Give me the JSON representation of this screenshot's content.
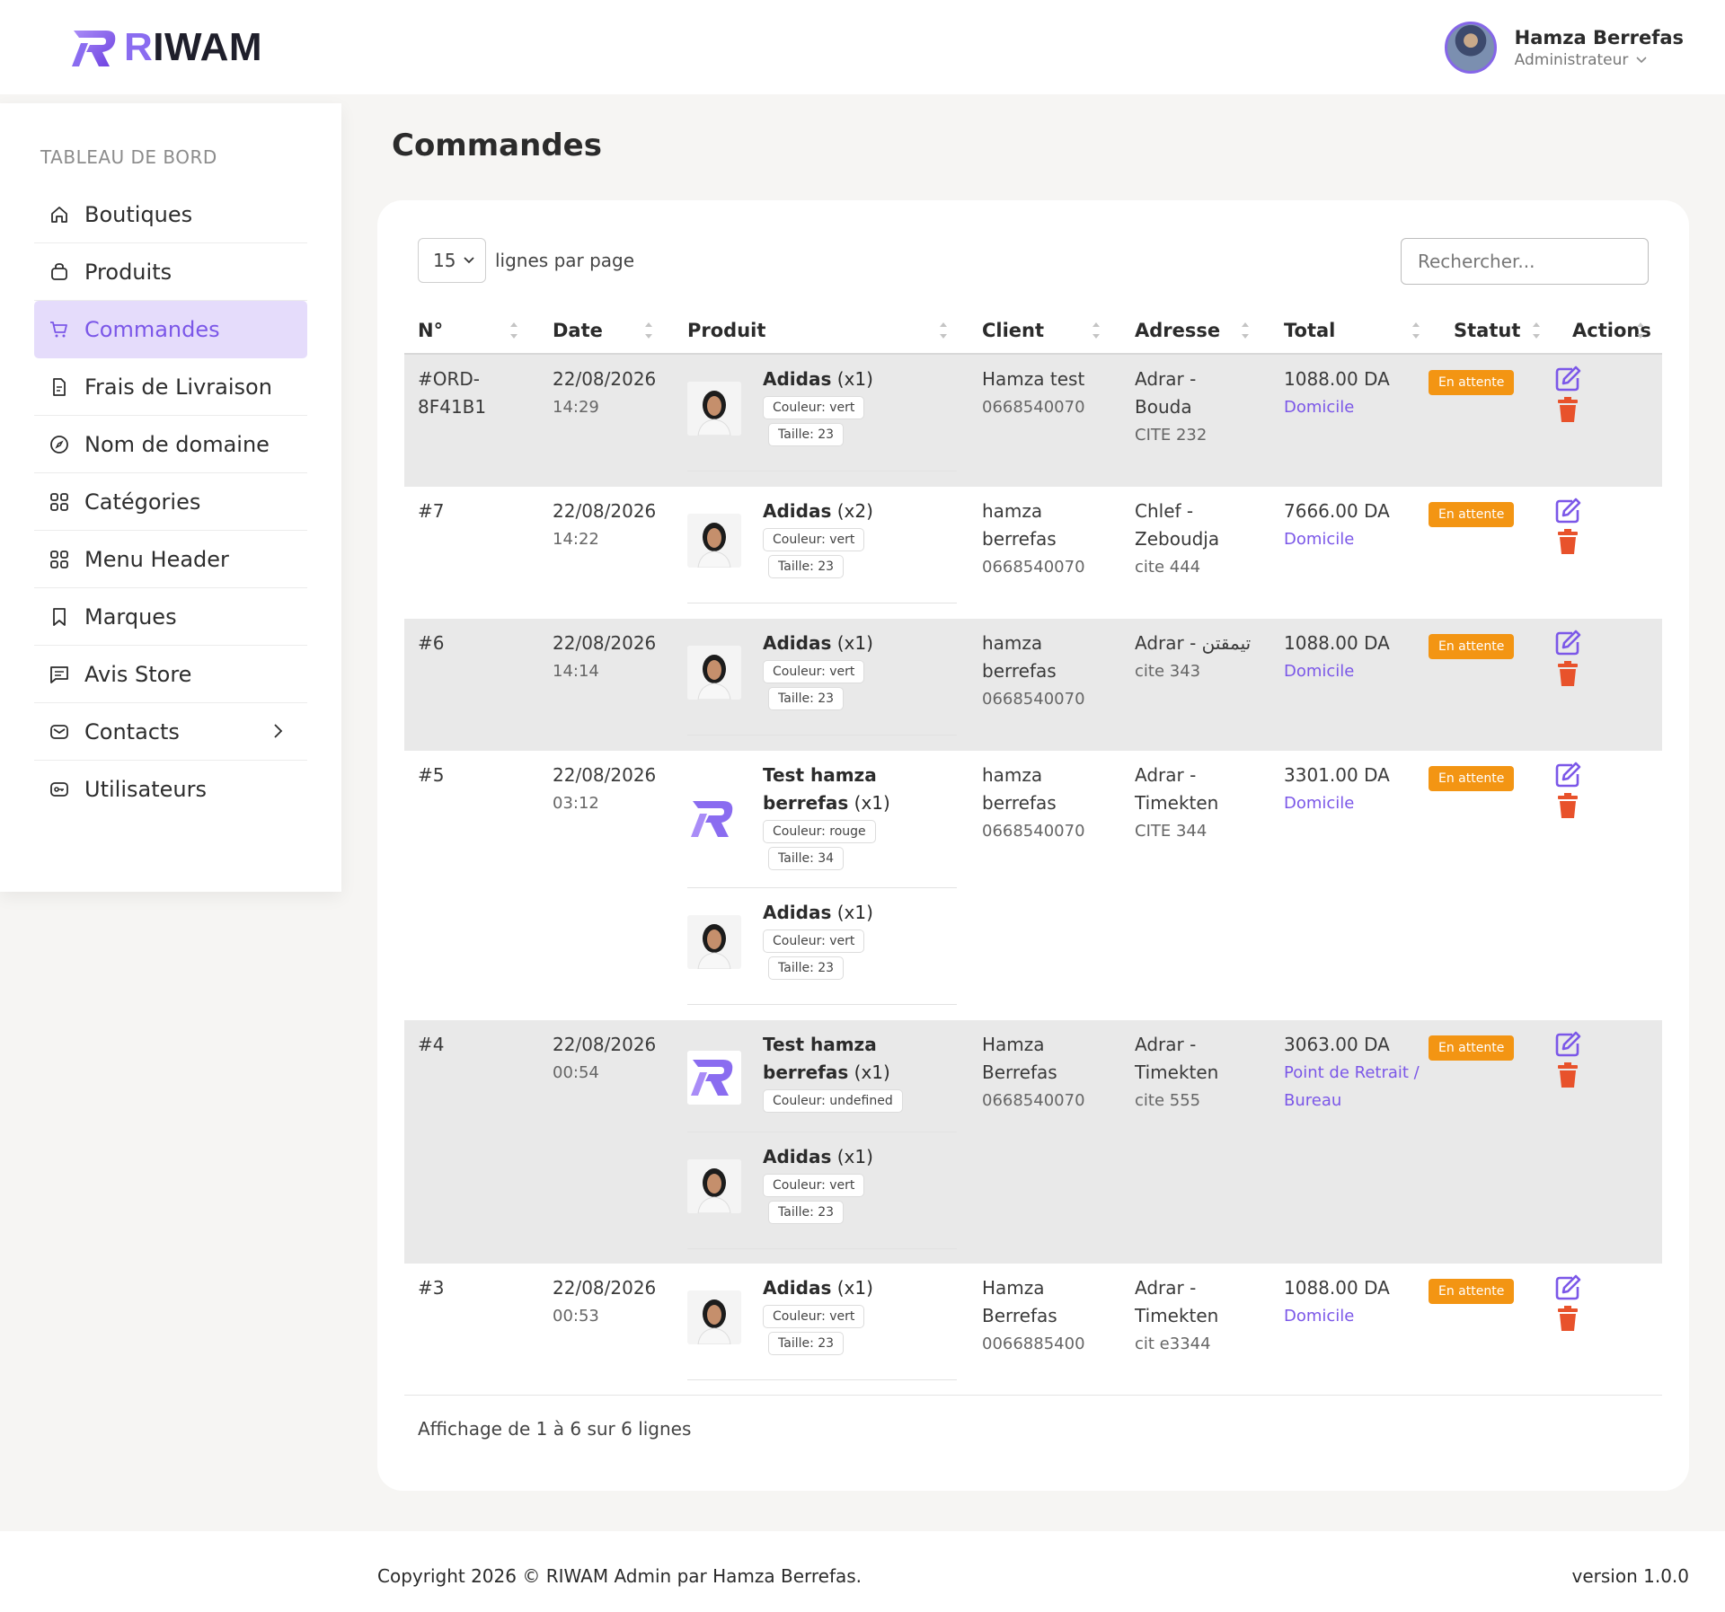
{
  "brand": {
    "name_first": "R",
    "name_rest": "IWAM",
    "accent": "#8a6cf0"
  },
  "user": {
    "name": "Hamza Berrefas",
    "role": "Administrateur"
  },
  "sidebar": {
    "title": "TABLEAU DE BORD",
    "items": [
      {
        "label": "Boutiques",
        "icon": "home-icon"
      },
      {
        "label": "Produits",
        "icon": "bag-icon"
      },
      {
        "label": "Commandes",
        "icon": "cart-icon",
        "active": true
      },
      {
        "label": "Frais de Livraison",
        "icon": "document-icon"
      },
      {
        "label": "Nom de domaine",
        "icon": "compass-icon"
      },
      {
        "label": "Catégories",
        "icon": "grid-icon"
      },
      {
        "label": "Menu Header",
        "icon": "grid-icon"
      },
      {
        "label": "Marques",
        "icon": "bookmark-icon"
      },
      {
        "label": "Avis Store",
        "icon": "comment-icon"
      },
      {
        "label": "Contacts",
        "icon": "mail-icon"
      },
      {
        "label": "Utilisateurs",
        "icon": "key-icon"
      }
    ]
  },
  "page": {
    "title": "Commandes"
  },
  "table": {
    "per_page_value": "15",
    "per_page_label": "lignes par page",
    "search_placeholder": "Rechercher...",
    "columns": [
      "N°",
      "Date",
      "Produit",
      "Client",
      "Adresse",
      "Total",
      "Statut",
      "Actions"
    ],
    "rows": [
      {
        "id_line1": "#ORD-",
        "id_line2": "8F41B1",
        "date": "22/08/2026",
        "time": "14:29",
        "products": [
          {
            "name": "Adidas",
            "qty": "(x1)",
            "color": "Couleur: vert",
            "size": "Taille: 23",
            "image": "woman-photo"
          }
        ],
        "client_name": "Hamza test",
        "client_name2": "",
        "client_phone": "0668540070",
        "address_line1": "Adrar -",
        "address_line2": "Bouda",
        "address_line3": "CITE 232",
        "total": "1088.00 DA",
        "delivery_line1": "Domicile",
        "delivery_line2": "",
        "status": "En attente"
      },
      {
        "id_line1": "#7",
        "id_line2": "",
        "date": "22/08/2026",
        "time": "14:22",
        "products": [
          {
            "name": "Adidas",
            "qty": "(x2)",
            "color": "Couleur: vert",
            "size": "Taille: 23",
            "image": "woman-photo"
          }
        ],
        "client_name": "hamza",
        "client_name2": "berrefas",
        "client_phone": "0668540070",
        "address_line1": "Chlef -",
        "address_line2": "Zeboudja",
        "address_line3": "cite 444",
        "total": "7666.00 DA",
        "delivery_line1": "Domicile",
        "delivery_line2": "",
        "status": "En attente"
      },
      {
        "id_line1": "#6",
        "id_line2": "",
        "date": "22/08/2026",
        "time": "14:14",
        "products": [
          {
            "name": "Adidas",
            "qty": "(x1)",
            "color": "Couleur: vert",
            "size": "Taille: 23",
            "image": "woman-photo"
          }
        ],
        "client_name": "hamza",
        "client_name2": "berrefas",
        "client_phone": "0668540070",
        "address_line1": "Adrar - تيمقتن",
        "address_line2": "",
        "address_line3": "cite 343",
        "total": "1088.00 DA",
        "delivery_line1": "Domicile",
        "delivery_line2": "",
        "status": "En attente"
      },
      {
        "id_line1": "#5",
        "id_line2": "",
        "date": "22/08/2026",
        "time": "03:12",
        "products": [
          {
            "name": "Test hamza berrefas",
            "qty": "(x1)",
            "color": "Couleur: rouge",
            "size": "Taille: 34",
            "image": "riwam-logo"
          },
          {
            "name": "Adidas",
            "qty": "(x1)",
            "color": "Couleur: vert",
            "size": "Taille: 23",
            "image": "woman-photo"
          }
        ],
        "client_name": "hamza",
        "client_name2": "berrefas",
        "client_phone": "0668540070",
        "address_line1": "Adrar -",
        "address_line2": "Timekten",
        "address_line3": "CITE 344",
        "total": "3301.00 DA",
        "delivery_line1": "Domicile",
        "delivery_line2": "",
        "status": "En attente"
      },
      {
        "id_line1": "#4",
        "id_line2": "",
        "date": "22/08/2026",
        "time": "00:54",
        "products": [
          {
            "name": "Test hamza berrefas",
            "qty": "(x1)",
            "color": "Couleur: undefined",
            "size": "",
            "image": "riwam-logo"
          },
          {
            "name": "Adidas",
            "qty": "(x1)",
            "color": "Couleur: vert",
            "size": "Taille: 23",
            "image": "woman-photo"
          }
        ],
        "client_name": "Hamza",
        "client_name2": "Berrefas",
        "client_phone": "0668540070",
        "address_line1": "Adrar -",
        "address_line2": "Timekten",
        "address_line3": "cite 555",
        "total": "3063.00 DA",
        "delivery_line1": "Point de Retrait /",
        "delivery_line2": "Bureau",
        "status": "En attente"
      },
      {
        "id_line1": "#3",
        "id_line2": "",
        "date": "22/08/2026",
        "time": "00:53",
        "products": [
          {
            "name": "Adidas",
            "qty": "(x1)",
            "color": "Couleur: vert",
            "size": "Taille: 23",
            "image": "woman-photo"
          }
        ],
        "client_name": "Hamza",
        "client_name2": "Berrefas",
        "client_phone": "0066885400",
        "address_line1": "Adrar -",
        "address_line2": "Timekten",
        "address_line3": "cit e3344",
        "total": "1088.00 DA",
        "delivery_line1": "Domicile",
        "delivery_line2": "",
        "status": "En attente"
      }
    ],
    "info": "Affichage de 1 à 6 sur 6 lignes"
  },
  "colors": {
    "accent": "#7b57e8",
    "status": "#f39513",
    "delete": "#e8522b",
    "row_alt": "#e9e9e9"
  },
  "footer": {
    "copyright": "Copyright 2026 © RIWAM Admin par Hamza Berrefas.",
    "version": "version 1.0.0"
  }
}
